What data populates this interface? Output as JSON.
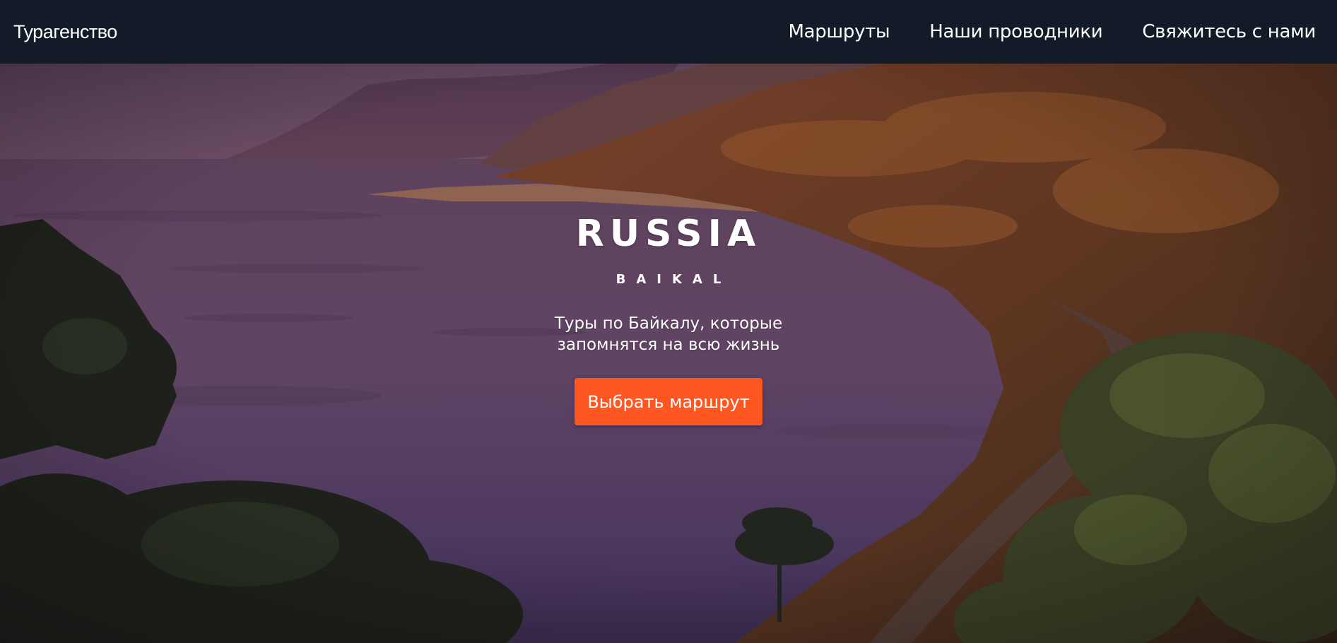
{
  "navbar": {
    "brand": "Турагенство",
    "links": [
      {
        "label": "Маршруты"
      },
      {
        "label": "Наши проводники"
      },
      {
        "label": "Свяжитесь с нами"
      }
    ],
    "background": "#141b28"
  },
  "hero": {
    "title": "RUSSIA",
    "subtitle": "BAIKAL",
    "tagline": "Туры по Байкалу, которые запомнятся на всю жизнь",
    "cta_label": "Выбрать маршрут",
    "cta_color": "#ff5722"
  }
}
